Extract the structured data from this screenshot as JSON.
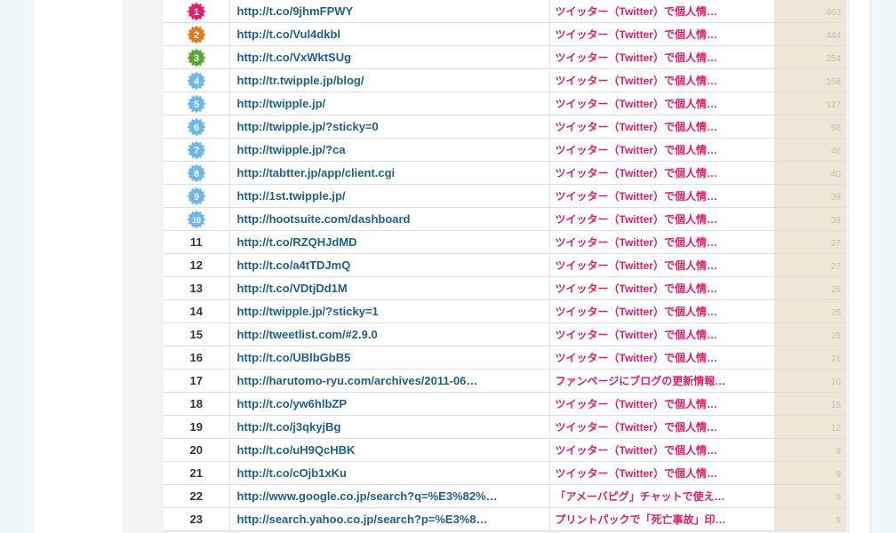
{
  "colors": {
    "link_url": "#1f5f8b",
    "link_title": "#e0206b",
    "badge_1": "#e0206b",
    "badge_2": "#e07a21",
    "badge_3": "#59a832",
    "badge_other": "#6cb8e8"
  },
  "icons": {
    "rank_badge": "starburst-rank-badge-icon"
  },
  "rows": [
    {
      "rank": "1",
      "url": "http://t.co/9jhmFPWY",
      "title": "ツイッター（Twitter）で個人情…",
      "count": "463"
    },
    {
      "rank": "2",
      "url": "http://t.co/Vul4dkbl",
      "title": "ツイッター（Twitter）で個人情…",
      "count": "444"
    },
    {
      "rank": "3",
      "url": "http://t.co/VxWktSUg",
      "title": "ツイッター（Twitter）で個人情…",
      "count": "254"
    },
    {
      "rank": "4",
      "url": "http://tr.twipple.jp/blog/",
      "title": "ツイッター（Twitter）で個人情…",
      "count": "158"
    },
    {
      "rank": "5",
      "url": "http://twipple.jp/",
      "title": "ツイッター（Twitter）で個人情…",
      "count": "127"
    },
    {
      "rank": "6",
      "url": "http://twipple.jp/?sticky=0",
      "title": "ツイッター（Twitter）で個人情…",
      "count": "58"
    },
    {
      "rank": "7",
      "url": "http://twipple.jp/?ca",
      "title": "ツイッター（Twitter）で個人情…",
      "count": "46"
    },
    {
      "rank": "8",
      "url": "http://tabtter.jp/app/client.cgi",
      "title": "ツイッター（Twitter）で個人情…",
      "count": "40"
    },
    {
      "rank": "9",
      "url": "http://1st.twipple.jp/",
      "title": "ツイッター（Twitter）で個人情…",
      "count": "39"
    },
    {
      "rank": "10",
      "url": "http://hootsuite.com/dashboard",
      "title": "ツイッター（Twitter）で個人情…",
      "count": "39"
    },
    {
      "rank": "11",
      "url": "http://t.co/RZQHJdMD",
      "title": "ツイッター（Twitter）で個人情…",
      "count": "27"
    },
    {
      "rank": "12",
      "url": "http://t.co/a4tTDJmQ",
      "title": "ツイッター（Twitter）で個人情…",
      "count": "27"
    },
    {
      "rank": "13",
      "url": "http://t.co/VDtjDd1M",
      "title": "ツイッター（Twitter）で個人情…",
      "count": "26"
    },
    {
      "rank": "14",
      "url": "http://twipple.jp/?sticky=1",
      "title": "ツイッター（Twitter）で個人情…",
      "count": "25"
    },
    {
      "rank": "15",
      "url": "http://tweetlist.com/#2.9.0",
      "title": "ツイッター（Twitter）で個人情…",
      "count": "25"
    },
    {
      "rank": "16",
      "url": "http://t.co/UBlbGbB5",
      "title": "ツイッター（Twitter）で個人情…",
      "count": "21"
    },
    {
      "rank": "17",
      "url": "http://harutomo-ryu.com/archives/2011-06…",
      "title": "ファンページにブログの更新情報…",
      "count": "16"
    },
    {
      "rank": "18",
      "url": "http://t.co/yw6hlbZP",
      "title": "ツイッター（Twitter）で個人情…",
      "count": "15"
    },
    {
      "rank": "19",
      "url": "http://t.co/j3qkyjBg",
      "title": "ツイッター（Twitter）で個人情…",
      "count": "12"
    },
    {
      "rank": "20",
      "url": "http://t.co/uH9QcHBK",
      "title": "ツイッター（Twitter）で個人情…",
      "count": "9"
    },
    {
      "rank": "21",
      "url": "http://t.co/cOjb1xKu",
      "title": "ツイッター（Twitter）で個人情…",
      "count": "9"
    },
    {
      "rank": "22",
      "url": "http://www.google.co.jp/search?q=%E3%82%…",
      "title": "「アメーバピグ」チャットで使え…",
      "count": "9"
    },
    {
      "rank": "23",
      "url": "http://search.yahoo.co.jp/search?p=%E3%8…",
      "title": "プリントパックで「死亡事故」印…",
      "count": "9"
    }
  ]
}
